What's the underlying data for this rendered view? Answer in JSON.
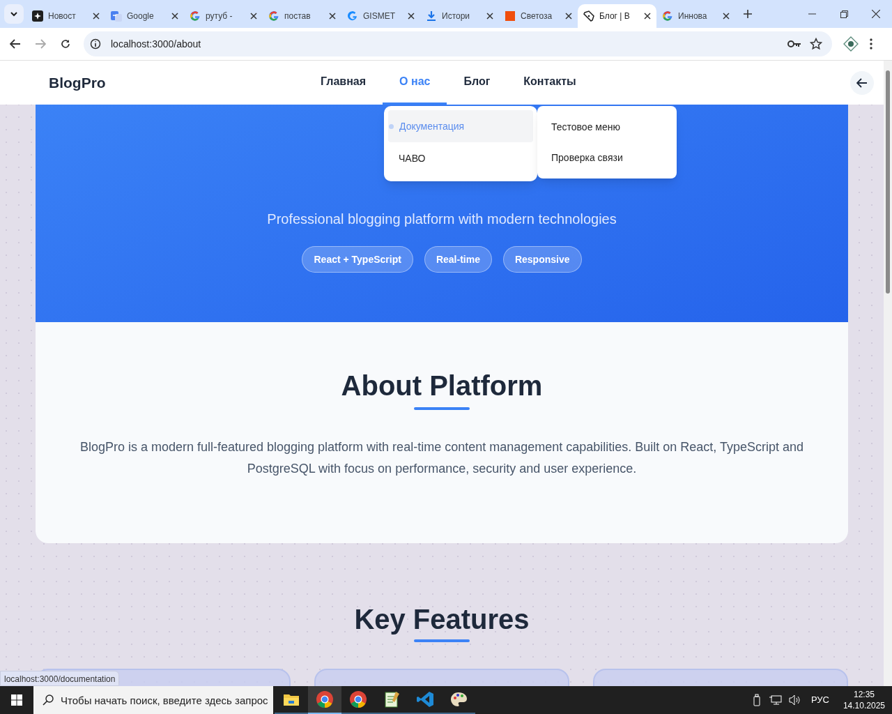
{
  "browser": {
    "tabs": [
      {
        "title": "Новост",
        "kind": "sparkle",
        "selected": false
      },
      {
        "title": "Google",
        "kind": "translate",
        "selected": false
      },
      {
        "title": "рутуб -",
        "kind": "google",
        "selected": false
      },
      {
        "title": "постав",
        "kind": "google",
        "selected": false
      },
      {
        "title": "GISMET",
        "kind": "gblue",
        "selected": false
      },
      {
        "title": "Истори",
        "kind": "download",
        "selected": false
      },
      {
        "title": "Светоза",
        "kind": "square",
        "selected": false
      },
      {
        "title": "Блог | В",
        "kind": "pen",
        "selected": true
      },
      {
        "title": "Иннова",
        "kind": "google",
        "selected": false
      }
    ],
    "address": "localhost:3000/about"
  },
  "site": {
    "logo": "BlogPro",
    "nav": [
      {
        "label": "Главная",
        "selected": false
      },
      {
        "label": "О нас",
        "selected": true
      },
      {
        "label": "Блог",
        "selected": false
      },
      {
        "label": "Контакты",
        "selected": false
      }
    ]
  },
  "dropdown": {
    "items": [
      {
        "label": "Документация",
        "highlighted": true
      },
      {
        "label": "ЧАВО",
        "highlighted": false
      }
    ],
    "submenu": [
      "Тестовое меню",
      "Проверка связи"
    ]
  },
  "hero": {
    "subtitle": "Professional blogging platform with modern technologies",
    "badges": [
      "React + TypeScript",
      "Real-time",
      "Responsive"
    ]
  },
  "about": {
    "title": "About Platform",
    "text": "BlogPro is a modern full-featured blogging platform with real-time content management capabilities. Built on React, TypeScript and PostgreSQL with focus on performance, security and user experience."
  },
  "features": {
    "title": "Key Features"
  },
  "status_url": "localhost:3000/documentation",
  "taskbar": {
    "search_placeholder": "Чтобы начать поиск, введите здесь запрос",
    "apps": [
      {
        "kind": "folder",
        "selected": false
      },
      {
        "kind": "chrome",
        "selected": true
      },
      {
        "kind": "chrome",
        "selected": false
      },
      {
        "kind": "notepad",
        "selected": false
      },
      {
        "kind": "vscode",
        "selected": false
      },
      {
        "kind": "paint",
        "selected": false
      }
    ],
    "language": "РУС",
    "time": "12:35",
    "date": "14.10.2025"
  }
}
